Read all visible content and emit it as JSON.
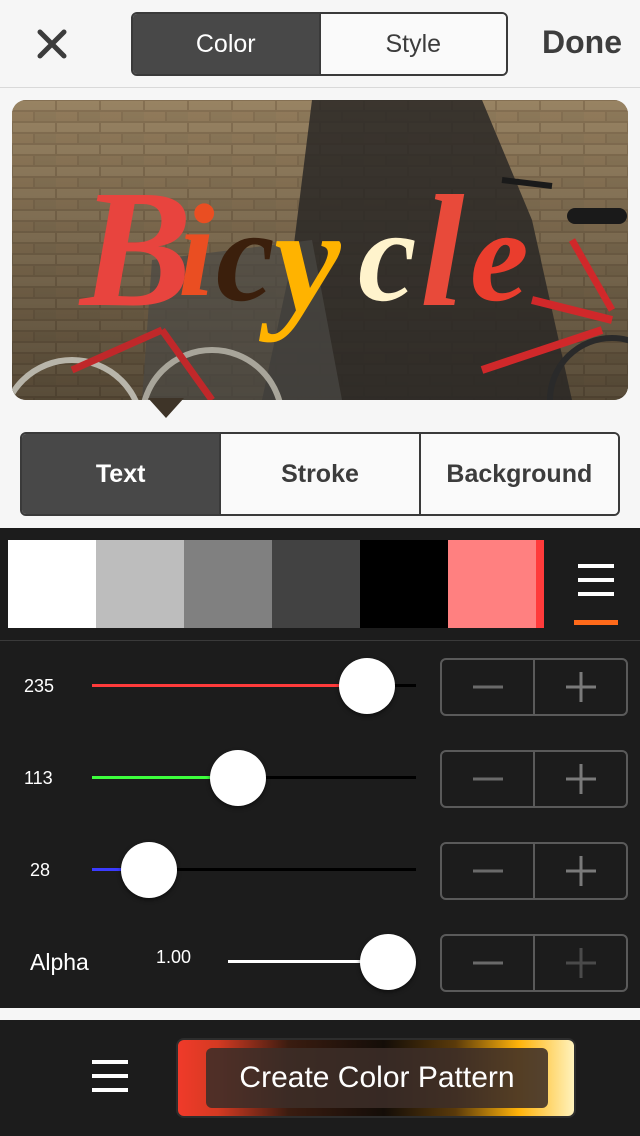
{
  "header": {
    "close_icon": "close-icon",
    "tabs": [
      {
        "label": "Color",
        "active": true
      },
      {
        "label": "Style",
        "active": false
      }
    ],
    "done_label": "Done"
  },
  "preview": {
    "title_text": "Bicycle",
    "letter_colors": [
      "#e8443e",
      "#ea4e22",
      "#3b1f0c",
      "#ffb300",
      "#fff3cc",
      "#e84a3a",
      "#ea3d2d"
    ]
  },
  "target_tabs": [
    {
      "label": "Text",
      "active": true
    },
    {
      "label": "Stroke",
      "active": false
    },
    {
      "label": "Background",
      "active": false
    }
  ],
  "palette": {
    "swatches": [
      "#ffffff",
      "#bdbdbd",
      "#808080",
      "#424242",
      "#000000",
      "#ff8080"
    ],
    "menu_icon": "menu-icon",
    "accent": "#ff6a1a"
  },
  "sliders": {
    "red": {
      "value": "235",
      "level": 0.92,
      "color": "#ff3b3b"
    },
    "green": {
      "value": "113",
      "level": 0.44,
      "color": "#3dff3d"
    },
    "blue": {
      "value": "28",
      "level": 0.11,
      "color": "#3b3bff"
    },
    "alpha": {
      "label": "Alpha",
      "value": "1.00",
      "level": 1.0,
      "color": "#ffffff"
    }
  },
  "stepper": {
    "minus_icon": "minus-icon",
    "plus_icon": "plus-icon"
  },
  "footer": {
    "menu_icon": "menu-icon",
    "pattern_label": "Create Color Pattern"
  }
}
